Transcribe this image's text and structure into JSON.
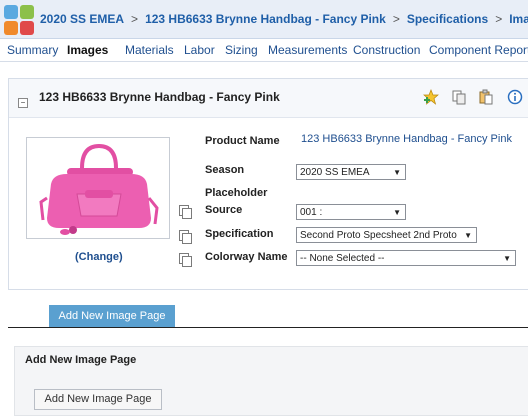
{
  "header": {
    "season": "2020 SS EMEA",
    "product": "123 HB6633 Brynne Handbag - Fancy Pink",
    "section": "Specifications",
    "page": "Images",
    "separator": ">"
  },
  "tabs": [
    "Summary",
    "Images",
    "Materials",
    "Labor",
    "Sizing",
    "Measurements",
    "Construction",
    "Component Report"
  ],
  "active_tab": "Images",
  "panel": {
    "collapse_symbol": "−",
    "title": "123 HB6633 Brynne Handbag - Fancy Pink",
    "change_link": "(Change)",
    "icons": [
      "star-add-icon",
      "copy-icon",
      "clipboard-icon",
      "info-icon"
    ]
  },
  "fields": {
    "product_name_label": "Product Name",
    "product_name_value": "123 HB6633 Brynne Handbag - Fancy Pink",
    "season_label": "Season",
    "season_value": "2020 SS EMEA",
    "placeholder_label": "Placeholder",
    "source_label": "Source",
    "source_value": "001 :",
    "specification_label": "Specification",
    "specification_value": "Second Proto Specsheet 2nd Proto",
    "colorway_label": "Colorway Name",
    "colorway_value": "-- None Selected --",
    "dropdown_arrow": "▼"
  },
  "add_tab_label": "Add New Image Page",
  "add_section": {
    "title": "Add New Image Page",
    "button_label": "Add New Image Page"
  },
  "colors": {
    "link": "#1f4f8f",
    "accent_tab": "#5aa0d0",
    "bag_pink": "#ec5fb1"
  }
}
